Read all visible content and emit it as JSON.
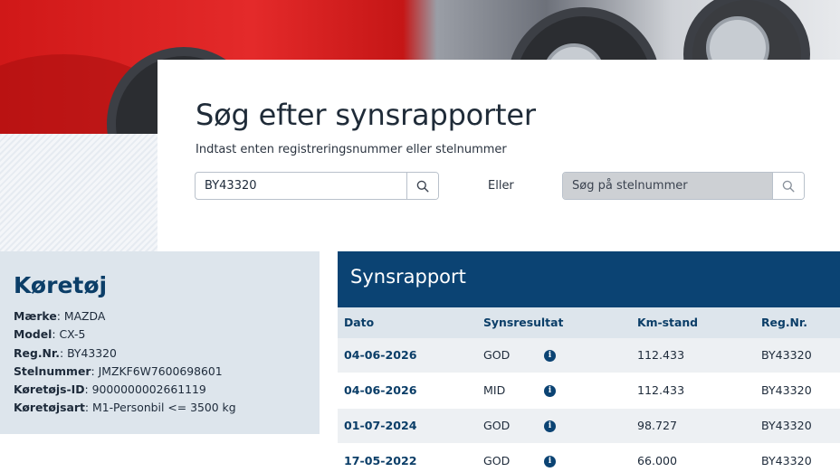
{
  "search": {
    "title": "Søg efter synsrapporter",
    "subtitle": "Indtast enten registreringsnummer eller stelnummer",
    "reg_value": "BY43320",
    "or_label": "Eller",
    "vin_placeholder": "Søg på stelnummer"
  },
  "vehicle": {
    "heading": "Køretøj",
    "fields": [
      {
        "label": "Mærke",
        "value": "MAZDA"
      },
      {
        "label": "Model",
        "value": "CX-5"
      },
      {
        "label": "Reg.Nr.",
        "value": "BY43320"
      },
      {
        "label": "Stelnummer",
        "value": "JMZKF6W7600698601"
      },
      {
        "label": "Køretøjs-ID",
        "value": "9000000002661119"
      },
      {
        "label": "Køretøjsart",
        "value": "M1-Personbil <= 3500 kg"
      }
    ]
  },
  "report": {
    "heading": "Synsrapport",
    "columns": [
      "Dato",
      "Synsresultat",
      "Km-stand",
      "Reg.Nr."
    ],
    "rows": [
      {
        "date": "04-06-2026",
        "result": "GOD",
        "km": "112.433",
        "reg": "BY43320"
      },
      {
        "date": "04-06-2026",
        "result": "MID",
        "km": "112.433",
        "reg": "BY43320"
      },
      {
        "date": "01-07-2024",
        "result": "GOD",
        "km": "98.727",
        "reg": "BY43320"
      },
      {
        "date": "17-05-2022",
        "result": "GOD",
        "km": "66.000",
        "reg": "BY43320"
      }
    ]
  },
  "icons": {
    "search": "search-icon",
    "info": "info-icon"
  },
  "colors": {
    "primary": "#0b4373",
    "panel": "#dde5ec"
  }
}
